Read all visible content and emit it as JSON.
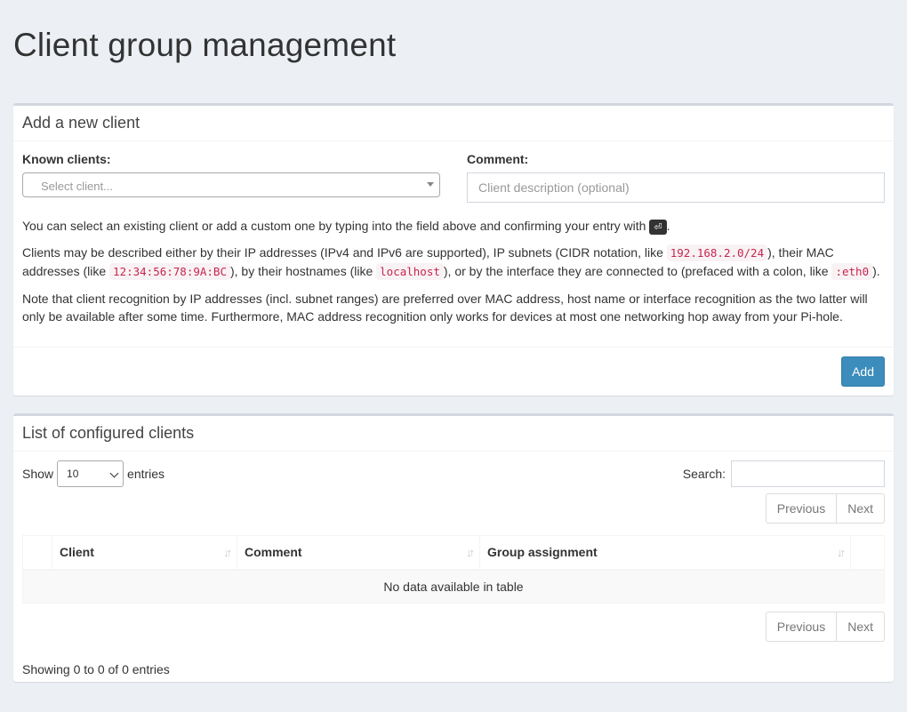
{
  "page": {
    "title": "Client group management"
  },
  "add_box": {
    "title": "Add a new client",
    "known_clients_label": "Known clients:",
    "select_placeholder": "Select client...",
    "comment_label": "Comment:",
    "comment_placeholder": "Client description (optional)",
    "help_line1": "You can select an existing client or add a custom one by typing into the field above and confirming your entry with",
    "enter_key": "⏎",
    "help_line1_end": ".",
    "help_line2_a": "Clients may be described either by their IP addresses (IPv4 and IPv6 are supported), IP subnets (CIDR notation, like ",
    "help_line2_code1": "192.168.2.0/24",
    "help_line2_b": "), their MAC addresses (like ",
    "help_line2_code2": "12:34:56:78:9A:BC",
    "help_line2_c": "), by their hostnames (like ",
    "help_line2_code3": "localhost",
    "help_line2_d": "), or by the interface they are connected to (prefaced with a colon, like ",
    "help_line2_code4": ":eth0",
    "help_line2_e": ").",
    "help_line3": "Note that client recognition by IP addresses (incl. subnet ranges) are preferred over MAC address, host name or interface recognition as the two latter will only be available after some time. Furthermore, MAC address recognition only works for devices at most one networking hop away from your Pi-hole.",
    "add_label": "Add"
  },
  "list_box": {
    "title": "List of configured clients",
    "show_label": "Show",
    "entries_label": "entries",
    "page_length": "10",
    "search_label": "Search:",
    "previous_label": "Previous",
    "next_label": "Next",
    "columns": [
      "Client",
      "Comment",
      "Group assignment"
    ],
    "empty_message": "No data available in table",
    "info": "Showing 0 to 0 of 0 entries"
  },
  "colors": {
    "background": "#ecf0f5",
    "primary": "#3c8dbc",
    "code": "#c7254e"
  }
}
